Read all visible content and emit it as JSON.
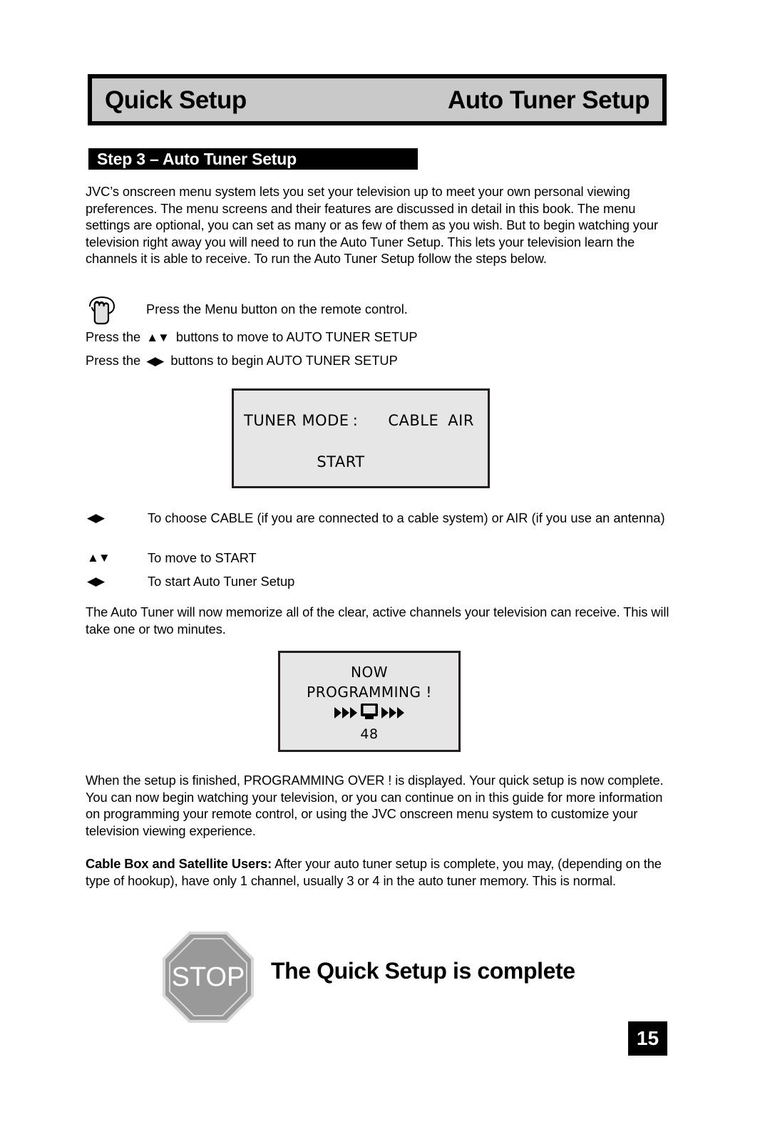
{
  "header": {
    "left_title": "Quick Setup",
    "right_title": "Auto Tuner Setup"
  },
  "step_banner": {
    "label": "Step 3 – Auto Tuner Setup"
  },
  "paragraphs": {
    "intro": "JVC’s onscreen menu system lets you set your television up to meet your own personal viewing preferences. The menu screens and their features are discussed in detail in this book. The menu settings are optional, you can set as many or as few of them as you wish. But to begin watching your television right away you will need to run the Auto Tuner Setup. This lets your television learn the channels it is able to receive. To run the Auto Tuner Setup follow the steps below.",
    "memorize": "The Auto Tuner will now memorize all of the clear, active channels your television can receive. This will take one or two minutes.",
    "finished": "When the setup is finished, PROGRAMMING OVER ! is displayed. Your quick setup is now complete. You can now begin watching your television, or you can continue on in this guide for more information on programming your remote control, or using the JVC onscreen menu system to customize your television viewing experience.",
    "cable_box_heading": "Cable Box and Satellite Users:",
    "cable_box_body": " After your auto tuner setup is complete, you may, (depending on the type of hookup), have only 1 channel, usually 3 or 4 in the auto tuner memory.  This is normal."
  },
  "instructions": {
    "hand_line": "Press the Menu button on the remote control.",
    "press_rows": [
      {
        "prefix": "Press the",
        "arrows": "▲▼",
        "suffix": "buttons to move to AUTO TUNER SETUP"
      },
      {
        "prefix": "Press the",
        "arrows": "◀▶",
        "suffix": "buttons to begin AUTO TUNER SETUP"
      }
    ],
    "arrow_items": [
      {
        "glyph": "◀▶",
        "text": "To choose CABLE (if you are connected to a cable system) or AIR (if you use an antenna)"
      },
      {
        "glyph": "▲▼",
        "text": "To move to START"
      },
      {
        "glyph": "◀▶",
        "text": "To start Auto Tuner Setup"
      }
    ]
  },
  "osd_tuner": {
    "label": "TUNER MODE",
    "colon": ":",
    "option_cable": "CABLE",
    "option_air": "AIR",
    "start": "START"
  },
  "osd_programming": {
    "line1": "NOW",
    "line2": "PROGRAMMING !",
    "channel": "48"
  },
  "stop": {
    "sign_text": "STOP",
    "caption": "The Quick Setup is complete"
  },
  "footer": {
    "page_number": "15"
  },
  "colors": {
    "header_fill": "#c9c9c9",
    "banner_fill": "#000000",
    "osd_fill": "#e6e6e6",
    "osd_border": "#231f20",
    "stop_fill": "#999999",
    "page_number_fill": "#000000"
  }
}
